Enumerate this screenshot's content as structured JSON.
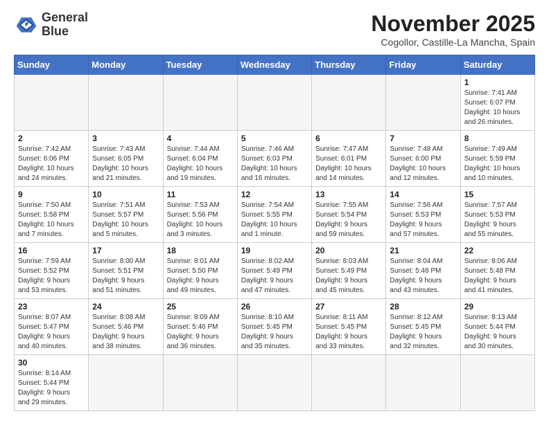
{
  "logo": {
    "line1": "General",
    "line2": "Blue"
  },
  "title": "November 2025",
  "subtitle": "Cogollor, Castille-La Mancha, Spain",
  "weekdays": [
    "Sunday",
    "Monday",
    "Tuesday",
    "Wednesday",
    "Thursday",
    "Friday",
    "Saturday"
  ],
  "weeks": [
    [
      {
        "day": null,
        "info": null
      },
      {
        "day": null,
        "info": null
      },
      {
        "day": null,
        "info": null
      },
      {
        "day": null,
        "info": null
      },
      {
        "day": null,
        "info": null
      },
      {
        "day": null,
        "info": null
      },
      {
        "day": "1",
        "info": "Sunrise: 7:41 AM\nSunset: 6:07 PM\nDaylight: 10 hours\nand 26 minutes."
      }
    ],
    [
      {
        "day": "2",
        "info": "Sunrise: 7:42 AM\nSunset: 6:06 PM\nDaylight: 10 hours\nand 24 minutes."
      },
      {
        "day": "3",
        "info": "Sunrise: 7:43 AM\nSunset: 6:05 PM\nDaylight: 10 hours\nand 21 minutes."
      },
      {
        "day": "4",
        "info": "Sunrise: 7:44 AM\nSunset: 6:04 PM\nDaylight: 10 hours\nand 19 minutes."
      },
      {
        "day": "5",
        "info": "Sunrise: 7:46 AM\nSunset: 6:03 PM\nDaylight: 10 hours\nand 16 minutes."
      },
      {
        "day": "6",
        "info": "Sunrise: 7:47 AM\nSunset: 6:01 PM\nDaylight: 10 hours\nand 14 minutes."
      },
      {
        "day": "7",
        "info": "Sunrise: 7:48 AM\nSunset: 6:00 PM\nDaylight: 10 hours\nand 12 minutes."
      },
      {
        "day": "8",
        "info": "Sunrise: 7:49 AM\nSunset: 5:59 PM\nDaylight: 10 hours\nand 10 minutes."
      }
    ],
    [
      {
        "day": "9",
        "info": "Sunrise: 7:50 AM\nSunset: 5:58 PM\nDaylight: 10 hours\nand 7 minutes."
      },
      {
        "day": "10",
        "info": "Sunrise: 7:51 AM\nSunset: 5:57 PM\nDaylight: 10 hours\nand 5 minutes."
      },
      {
        "day": "11",
        "info": "Sunrise: 7:53 AM\nSunset: 5:56 PM\nDaylight: 10 hours\nand 3 minutes."
      },
      {
        "day": "12",
        "info": "Sunrise: 7:54 AM\nSunset: 5:55 PM\nDaylight: 10 hours\nand 1 minute."
      },
      {
        "day": "13",
        "info": "Sunrise: 7:55 AM\nSunset: 5:54 PM\nDaylight: 9 hours\nand 59 minutes."
      },
      {
        "day": "14",
        "info": "Sunrise: 7:56 AM\nSunset: 5:53 PM\nDaylight: 9 hours\nand 57 minutes."
      },
      {
        "day": "15",
        "info": "Sunrise: 7:57 AM\nSunset: 5:53 PM\nDaylight: 9 hours\nand 55 minutes."
      }
    ],
    [
      {
        "day": "16",
        "info": "Sunrise: 7:59 AM\nSunset: 5:52 PM\nDaylight: 9 hours\nand 53 minutes."
      },
      {
        "day": "17",
        "info": "Sunrise: 8:00 AM\nSunset: 5:51 PM\nDaylight: 9 hours\nand 51 minutes."
      },
      {
        "day": "18",
        "info": "Sunrise: 8:01 AM\nSunset: 5:50 PM\nDaylight: 9 hours\nand 49 minutes."
      },
      {
        "day": "19",
        "info": "Sunrise: 8:02 AM\nSunset: 5:49 PM\nDaylight: 9 hours\nand 47 minutes."
      },
      {
        "day": "20",
        "info": "Sunrise: 8:03 AM\nSunset: 5:49 PM\nDaylight: 9 hours\nand 45 minutes."
      },
      {
        "day": "21",
        "info": "Sunrise: 8:04 AM\nSunset: 5:48 PM\nDaylight: 9 hours\nand 43 minutes."
      },
      {
        "day": "22",
        "info": "Sunrise: 8:06 AM\nSunset: 5:48 PM\nDaylight: 9 hours\nand 41 minutes."
      }
    ],
    [
      {
        "day": "23",
        "info": "Sunrise: 8:07 AM\nSunset: 5:47 PM\nDaylight: 9 hours\nand 40 minutes."
      },
      {
        "day": "24",
        "info": "Sunrise: 8:08 AM\nSunset: 5:46 PM\nDaylight: 9 hours\nand 38 minutes."
      },
      {
        "day": "25",
        "info": "Sunrise: 8:09 AM\nSunset: 5:46 PM\nDaylight: 9 hours\nand 36 minutes."
      },
      {
        "day": "26",
        "info": "Sunrise: 8:10 AM\nSunset: 5:45 PM\nDaylight: 9 hours\nand 35 minutes."
      },
      {
        "day": "27",
        "info": "Sunrise: 8:11 AM\nSunset: 5:45 PM\nDaylight: 9 hours\nand 33 minutes."
      },
      {
        "day": "28",
        "info": "Sunrise: 8:12 AM\nSunset: 5:45 PM\nDaylight: 9 hours\nand 32 minutes."
      },
      {
        "day": "29",
        "info": "Sunrise: 8:13 AM\nSunset: 5:44 PM\nDaylight: 9 hours\nand 30 minutes."
      }
    ],
    [
      {
        "day": "30",
        "info": "Sunrise: 8:14 AM\nSunset: 5:44 PM\nDaylight: 9 hours\nand 29 minutes."
      },
      {
        "day": null,
        "info": null
      },
      {
        "day": null,
        "info": null
      },
      {
        "day": null,
        "info": null
      },
      {
        "day": null,
        "info": null
      },
      {
        "day": null,
        "info": null
      },
      {
        "day": null,
        "info": null
      }
    ]
  ]
}
